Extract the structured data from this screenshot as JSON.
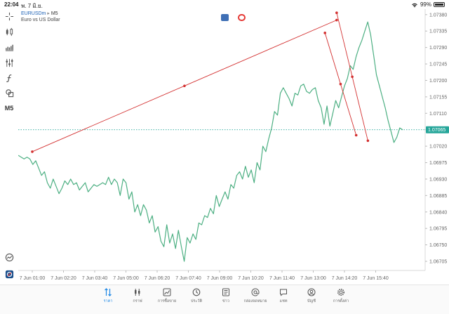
{
  "status": {
    "time": "22:04",
    "date": "พ. 7 มิ.ย.",
    "battery": "99%"
  },
  "symbol": {
    "name": "EURUSDm",
    "timeframe": "M5",
    "description": "Euro vs US Dollar"
  },
  "toolbar": {
    "timeframe_label": "M5",
    "icons": [
      "crosshair-icon",
      "candlestick-icon",
      "chart-type-icon",
      "indicators-icon",
      "function-icon",
      "objects-icon",
      "timeframe-label",
      "trade-history-icon",
      "app-logo-icon"
    ]
  },
  "colors": {
    "price_line": "#4caf82",
    "trendline": "#d32f2f",
    "current_price_bg": "#26a69a",
    "accent": "#1e88e5",
    "axis_text": "#666666",
    "grid": "#f0f0f0"
  },
  "chart_data": {
    "type": "line",
    "symbol": "EURUSDm",
    "timeframe": "M5",
    "y_ticks": [
      "1.07380",
      "1.07335",
      "1.07290",
      "1.07245",
      "1.07200",
      "1.07155",
      "1.07110",
      "1.07065",
      "1.07020",
      "1.06975",
      "1.06930",
      "1.06885",
      "1.06840",
      "1.06795",
      "1.06750",
      "1.06705"
    ],
    "ylim": [
      1.0668,
      1.07395
    ],
    "x_ticks": [
      "7 Jun 01:00",
      "7 Jun 02:20",
      "7 Jun 03:40",
      "7 Jun 05:00",
      "7 Jun 06:20",
      "7 Jun 07:40",
      "7 Jun 09:00",
      "7 Jun 10:20",
      "7 Jun 11:40",
      "7 Jun 13:00",
      "7 Jun 14:20",
      "7 Jun 15:40"
    ],
    "current_price": "1.07065",
    "price_series": [
      1.06995,
      1.0699,
      1.06985,
      1.0699,
      1.06985,
      1.0697,
      1.0698,
      1.0696,
      1.0694,
      1.0695,
      1.0692,
      1.06905,
      1.0693,
      1.0691,
      1.0689,
      1.06905,
      1.06925,
      1.06915,
      1.0693,
      1.06915,
      1.0692,
      1.069,
      1.0691,
      1.0692,
      1.06895,
      1.06905,
      1.06915,
      1.0691,
      1.06915,
      1.0692,
      1.06915,
      1.06935,
      1.06915,
      1.0693,
      1.0692,
      1.06885,
      1.0693,
      1.0692,
      1.06875,
      1.06895,
      1.0684,
      1.0686,
      1.0683,
      1.0686,
      1.06845,
      1.0681,
      1.0683,
      1.06785,
      1.068,
      1.0676,
      1.06745,
      1.06805,
      1.06755,
      1.0678,
      1.0674,
      1.0679,
      1.06745,
      1.06705,
      1.0677,
      1.06755,
      1.0678,
      1.06765,
      1.0681,
      1.06805,
      1.0683,
      1.06825,
      1.0685,
      1.06835,
      1.06885,
      1.06855,
      1.06875,
      1.06895,
      1.06875,
      1.06915,
      1.06905,
      1.0694,
      1.0695,
      1.0693,
      1.06965,
      1.06935,
      1.06955,
      1.0692,
      1.06975,
      1.06955,
      1.0702,
      1.07005,
      1.0704,
      1.0707,
      1.07115,
      1.07105,
      1.07165,
      1.0718,
      1.07165,
      1.0715,
      1.0713,
      1.07165,
      1.0716,
      1.07185,
      1.0719,
      1.0717,
      1.07165,
      1.07175,
      1.0718,
      1.07145,
      1.07125,
      1.0708,
      1.0713,
      1.07075,
      1.0711,
      1.07145,
      1.07125,
      1.07155,
      1.07185,
      1.07205,
      1.0724,
      1.0723,
      1.07265,
      1.0729,
      1.0731,
      1.07335,
      1.0736,
      1.07325,
      1.0727,
      1.07215,
      1.07185,
      1.07155,
      1.07125,
      1.0709,
      1.0706,
      1.0703,
      1.07045,
      1.0707,
      1.07065
    ],
    "trendlines": [
      {
        "from": [
          "7 Jun 01:00",
          1.07005
        ],
        "to": [
          "7 Jun 14:00",
          1.07365
        ]
      },
      {
        "from": [
          "7 Jun 13:30",
          1.0733
        ],
        "to": [
          "7 Jun 14:50",
          1.0705
        ]
      },
      {
        "from": [
          "7 Jun 14:00",
          1.07385
        ],
        "to": [
          "7 Jun 15:20",
          1.07035
        ]
      }
    ]
  },
  "nav": [
    {
      "key": "quotes",
      "label": "ราคา",
      "active": true
    },
    {
      "key": "chart",
      "label": "กราฟ"
    },
    {
      "key": "trade",
      "label": "การซื้อขาย"
    },
    {
      "key": "history",
      "label": "ประวัติ"
    },
    {
      "key": "news",
      "label": "ข่าว"
    },
    {
      "key": "mailbox",
      "label": "กล่องจดหมาย"
    },
    {
      "key": "chat",
      "label": "แชท"
    },
    {
      "key": "account",
      "label": "บัญชี"
    },
    {
      "key": "settings",
      "label": "การตั้งค่า"
    }
  ]
}
